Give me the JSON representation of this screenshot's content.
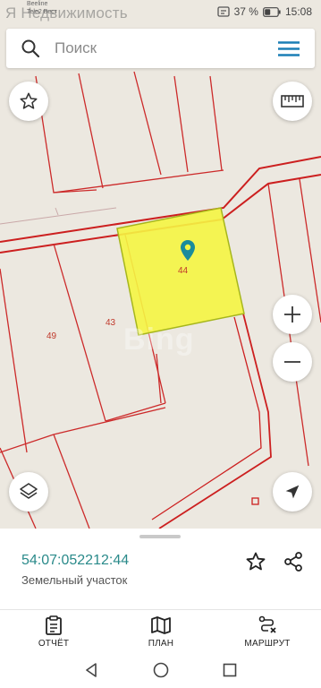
{
  "status_bar": {
    "operator_line1": "Beeline",
    "operator_line2": "Tele2 Вест",
    "brand_watermark": "Я Недвижимость",
    "battery": "37 %",
    "time": "15:08"
  },
  "search": {
    "placeholder": "Поиск"
  },
  "map": {
    "plot_labels": {
      "selected": "44",
      "left": "49",
      "middle": "43"
    },
    "watermark": "Bing",
    "selected_fill": "#f5f542",
    "boundary_color": "#cc1f1f",
    "marker_color": "#1a8c9c"
  },
  "details": {
    "cadastral_number": "54:07:052212:44",
    "land_type": "Земельный участок"
  },
  "bottom_nav": {
    "report": "ОТЧЁТ",
    "plan": "ПЛАН",
    "route": "МАРШРУТ"
  }
}
